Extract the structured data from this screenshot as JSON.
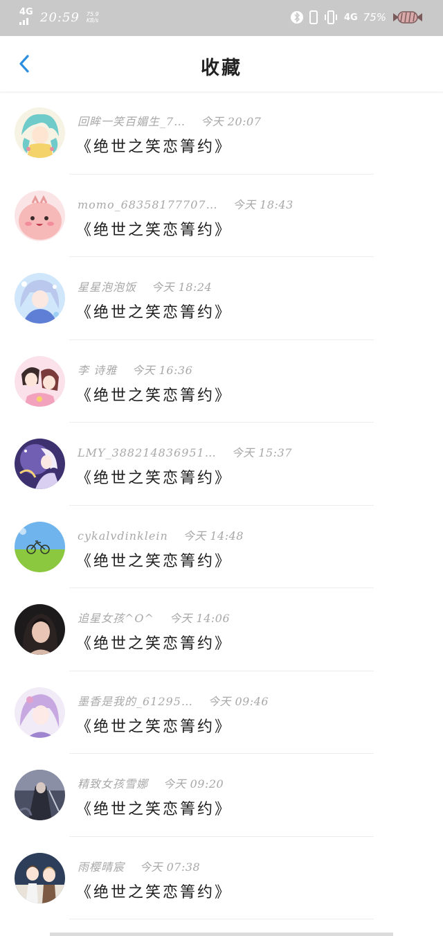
{
  "status_bar": {
    "network_left": "4G",
    "time": "20:59",
    "speed_value": "75.9",
    "speed_unit": "KB/s",
    "network_right": "4G",
    "battery": "75%"
  },
  "header": {
    "title": "收藏"
  },
  "items": [
    {
      "username": "回眸一笑百媚生_7…",
      "time": "今天 20:07",
      "message": "《绝世之笑恋箐约》",
      "avatar": "anime-girl-teal-hair-avatar"
    },
    {
      "username": "momo_68358177707…",
      "time": "今天 18:43",
      "message": "《绝世之笑恋箐约》",
      "avatar": "pink-cartoon-blob-avatar"
    },
    {
      "username": "星星泡泡饭",
      "time": "今天 18:24",
      "message": "《绝世之笑恋箐约》",
      "avatar": "anime-girl-blue-avatar"
    },
    {
      "username": "李 诗雅",
      "time": "今天 16:36",
      "message": "《绝世之笑恋箐约》",
      "avatar": "anime-couple-pink-avatar"
    },
    {
      "username": "LMY_388214836951…",
      "time": "今天 15:37",
      "message": "《绝世之笑恋箐约》",
      "avatar": "fantasy-purple-avatar"
    },
    {
      "username": "cykalvdinklein",
      "time": "今天 14:48",
      "message": "《绝世之笑恋箐约》",
      "avatar": "bicycle-on-grass-avatar"
    },
    {
      "username": "追星女孩^O^",
      "time": "今天 14:06",
      "message": "《绝世之笑恋箐约》",
      "avatar": "girl-photo-dark-avatar"
    },
    {
      "username": "墨香是我的_61295…",
      "time": "今天 09:46",
      "message": "《绝世之笑恋箐约》",
      "avatar": "anime-girl-lilac-avatar"
    },
    {
      "username": "精致女孩雪娜",
      "time": "今天 09:20",
      "message": "《绝世之笑恋箐约》",
      "avatar": "dark-fantasy-warrior-avatar"
    },
    {
      "username": "雨樱晴宸",
      "time": "今天 07:38",
      "message": "《绝世之笑恋箐约》",
      "avatar": "anime-duo-avatar"
    }
  ]
}
